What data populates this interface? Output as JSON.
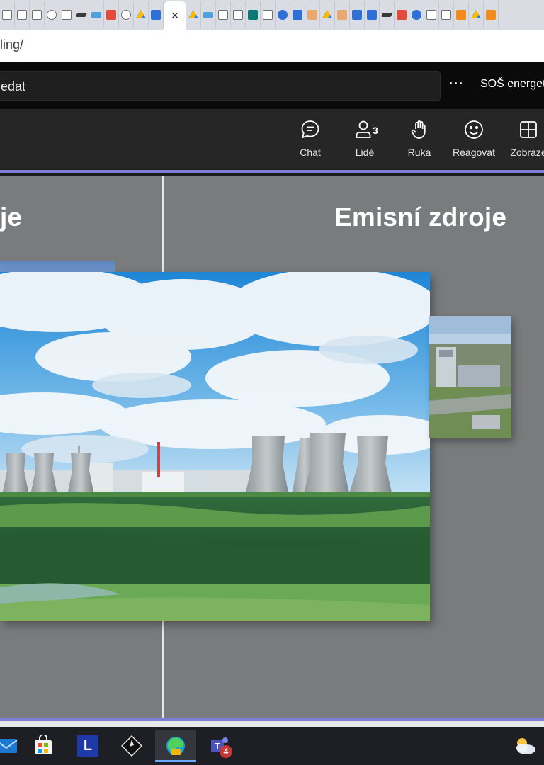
{
  "browser": {
    "url_fragment": "lling/",
    "active_tab_close": "×"
  },
  "teams": {
    "search_fragment": "edat",
    "more_options": "···",
    "org_name": "SOŠ energet"
  },
  "toolbar": {
    "chat_label": "Chat",
    "people_label": "Lidé",
    "people_count": "3",
    "raise_hand_label": "Ruka",
    "react_label": "Reagovat",
    "view_label": "Zobraze"
  },
  "presentation": {
    "left_title_fragment": "je",
    "title": "Emisní zdroje"
  },
  "taskbar": {
    "launcher_letter": "L",
    "teams_badge": "4"
  },
  "colors": {
    "accent_line": "#7b7fd8",
    "teams_header": "#0a0a0a",
    "meeting_bar": "#262626",
    "stage": "#7a7b7d",
    "taskbar": "#1d1f24"
  }
}
